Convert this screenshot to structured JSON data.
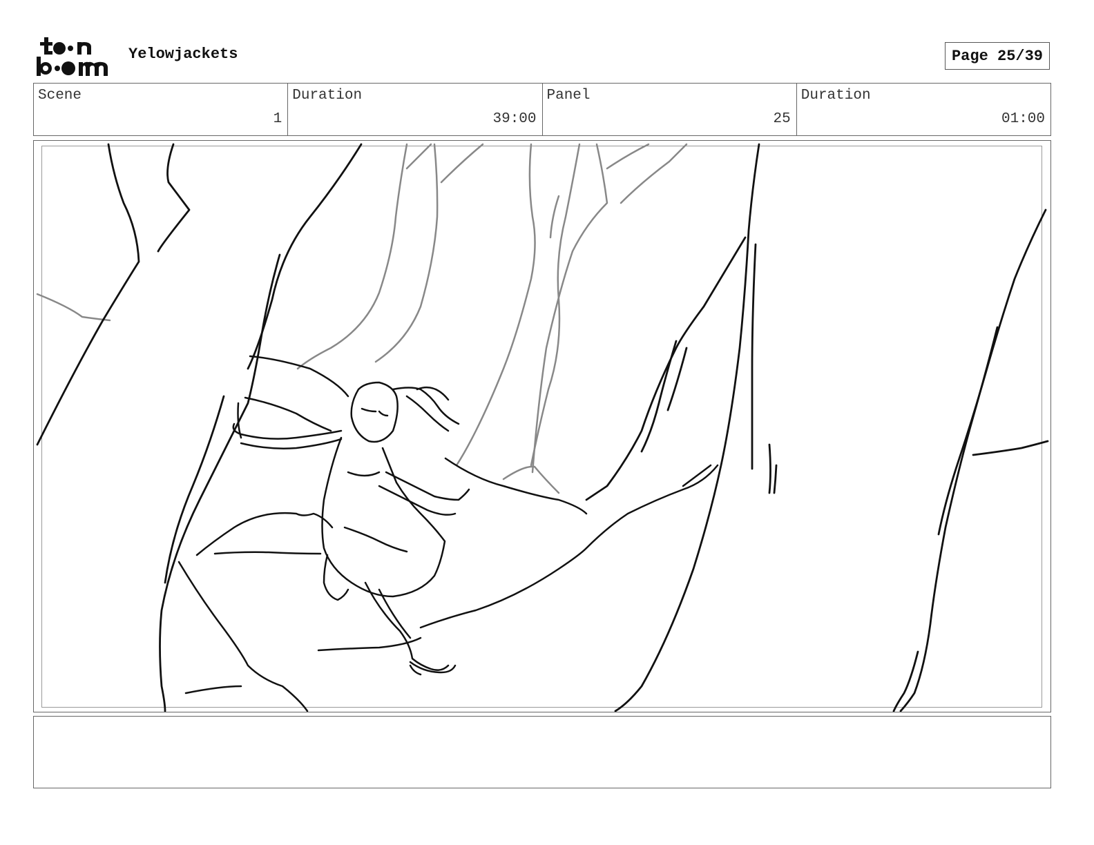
{
  "header": {
    "logo_text": "toon boom",
    "project_title": "Yelowjackets",
    "page_label": "Page 25/39"
  },
  "info": {
    "scene_label": "Scene",
    "scene_value": "1",
    "scene_duration_label": "Duration",
    "scene_duration_value": "39:00",
    "panel_label": "Panel",
    "panel_value": "25",
    "panel_duration_label": "Duration",
    "panel_duration_value": "01:00"
  },
  "panel": {
    "image_icon": "sketch-drawing"
  },
  "notes": {
    "text": ""
  }
}
